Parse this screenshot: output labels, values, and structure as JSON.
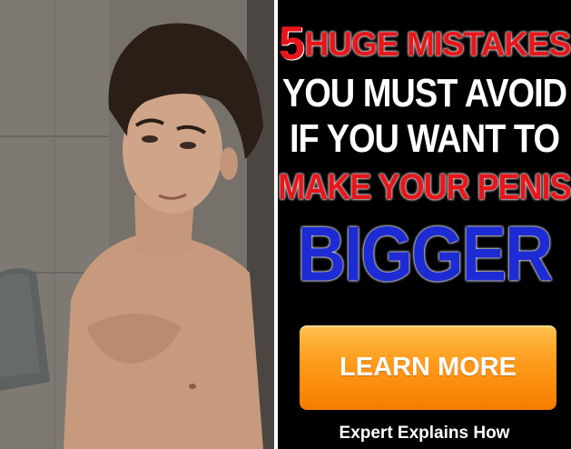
{
  "ad": {
    "headline": {
      "number": "5",
      "line1": "HUGE MISTAKES",
      "line2": "YOU MUST AVOID",
      "line3": "IF YOU WANT TO",
      "line4": "MAKE YOUR PENIS",
      "line5": "BIGGER"
    },
    "cta_label": "LEARN MORE",
    "footer": "Expert Explains How"
  },
  "colors": {
    "red": "#e8161b",
    "blue": "#1d2bd4",
    "white": "#ffffff",
    "orange": "#ff9a1a",
    "background": "#000000"
  },
  "photo": {
    "subject": "shirtless-man-selfie"
  }
}
